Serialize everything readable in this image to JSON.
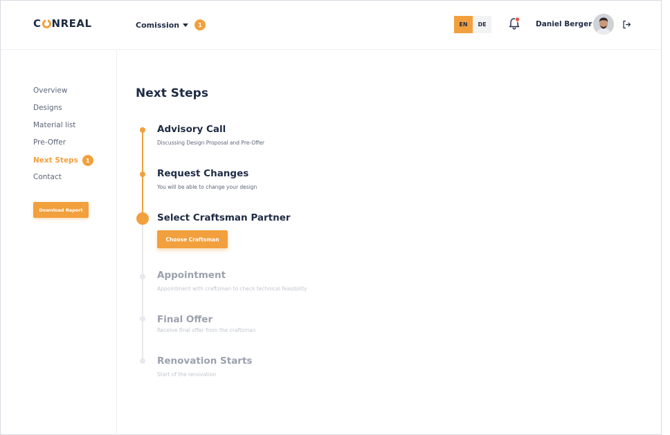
{
  "header": {
    "logo": {
      "pre": "C",
      "post": "NREAL"
    },
    "commission_label": "Comission",
    "commission_badge": "1",
    "languages": [
      {
        "code": "EN",
        "active": true
      },
      {
        "code": "DE",
        "active": false
      }
    ],
    "user_name": "Daniel Berger"
  },
  "sidebar": {
    "items": [
      {
        "label": "Overview"
      },
      {
        "label": "Designs"
      },
      {
        "label": "Material list"
      },
      {
        "label": "Pre-Offer"
      },
      {
        "label": "Next Steps",
        "active": true,
        "badge": "1"
      },
      {
        "label": "Contact"
      }
    ],
    "download_label": "Download Report"
  },
  "main": {
    "title": "Next Steps",
    "steps": [
      {
        "title": "Advisory Call",
        "desc": "Discussing Design Proposal and Pre-Offer",
        "state": "done"
      },
      {
        "title": "Request Changes",
        "desc": "You will be able to change your design",
        "state": "done"
      },
      {
        "title": "Select Craftsman Partner",
        "button": "Choose Craftsman",
        "state": "current"
      },
      {
        "title": "Appointment",
        "desc": "Appointment with craftsman to check technical feasibility",
        "state": "todo"
      },
      {
        "title": "Final Offer",
        "desc": "Receive final offer from the craftsman",
        "state": "todo"
      },
      {
        "title": "Renovation Starts",
        "desc": "Start of the renovation",
        "state": "todo"
      }
    ]
  },
  "colors": {
    "accent": "#f2a03d",
    "text": "#1f2b44",
    "muted": "#9aa1ae",
    "notification": "#e8574c"
  }
}
